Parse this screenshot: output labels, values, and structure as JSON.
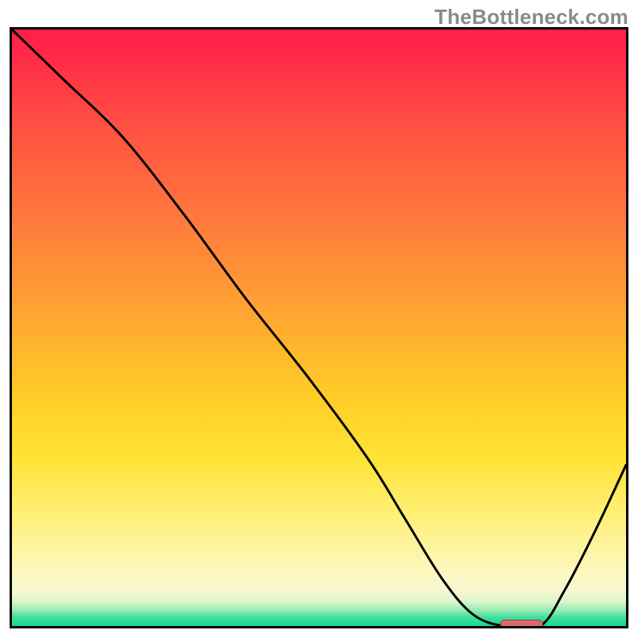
{
  "watermark": "TheBottleneck.com",
  "chart_data": {
    "type": "line",
    "title": "",
    "xlabel": "",
    "ylabel": "",
    "xlim": [
      0,
      100
    ],
    "ylim": [
      0,
      100
    ],
    "grid": false,
    "legend": false,
    "series": [
      {
        "name": "curve",
        "x": [
          0,
          8,
          18,
          28,
          38,
          48,
          58,
          64,
          70,
          75,
          80,
          86,
          90,
          95,
          100
        ],
        "y": [
          100,
          92,
          82,
          69,
          55,
          42,
          28,
          18,
          8,
          2,
          0,
          0,
          6,
          16,
          27
        ]
      }
    ],
    "marker": {
      "x_center": 83,
      "y": 0,
      "width_pct": 7,
      "height_pct": 1.3
    },
    "background_gradient": {
      "top": "#ff1f4a",
      "mid_upper": "#ff8a38",
      "mid": "#ffe336",
      "lower": "#f8f8d2",
      "bottom": "#17d98f"
    }
  }
}
